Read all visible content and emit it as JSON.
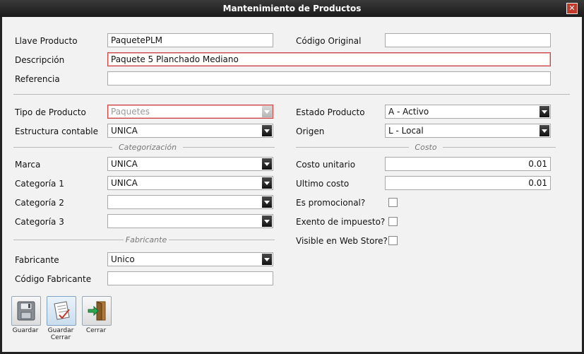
{
  "window": {
    "title": "Mantenimiento de Productos"
  },
  "fields": {
    "llave_producto": {
      "label": "Llave Producto",
      "value": "PaquetePLM"
    },
    "codigo_original": {
      "label": "Código Original",
      "value": ""
    },
    "descripcion": {
      "label": "Descripción",
      "value": "Paquete 5 Planchado Mediano"
    },
    "referencia": {
      "label": "Referencia",
      "value": ""
    },
    "tipo_producto": {
      "label": "Tipo de Producto",
      "value": "Paquetes"
    },
    "estado_producto": {
      "label": "Estado Producto",
      "value": "A - Activo"
    },
    "estructura_contable": {
      "label": "Estructura contable",
      "value": "UNICA"
    },
    "origen": {
      "label": "Origen",
      "value": "L - Local"
    },
    "marca": {
      "label": "Marca",
      "value": "UNICA"
    },
    "categoria1": {
      "label": "Categoría 1",
      "value": "UNICA"
    },
    "categoria2": {
      "label": "Categoría 2",
      "value": ""
    },
    "categoria3": {
      "label": "Categoría 3",
      "value": ""
    },
    "fabricante": {
      "label": "Fabricante",
      "value": "Unico"
    },
    "codigo_fabricante": {
      "label": "Código Fabricante",
      "value": ""
    },
    "costo_unitario": {
      "label": "Costo unitario",
      "value": "0.01"
    },
    "ultimo_costo": {
      "label": "Ultimo costo",
      "value": "0.01"
    },
    "es_promocional": {
      "label": "Es promocional?",
      "checked": false
    },
    "exento_impuesto": {
      "label": "Exento de impuesto?",
      "checked": false
    },
    "visible_web": {
      "label": "Visible en Web Store?",
      "checked": false
    }
  },
  "sections": {
    "categorizacion": "Categorización",
    "costo": "Costo",
    "fabricante": "Fabricante"
  },
  "toolbar": {
    "guardar": {
      "line1": "Guardar",
      "icon": "floppy-disk-icon"
    },
    "guardar_cerrar": {
      "line1": "Guardar",
      "line2": "Cerrar",
      "icon": "document-save-icon"
    },
    "cerrar": {
      "line1": "Cerrar",
      "icon": "door-exit-icon"
    }
  },
  "colors": {
    "required_border": "#c44",
    "titlebar": "#2a2a2a",
    "panel": "#f2f2f2"
  }
}
